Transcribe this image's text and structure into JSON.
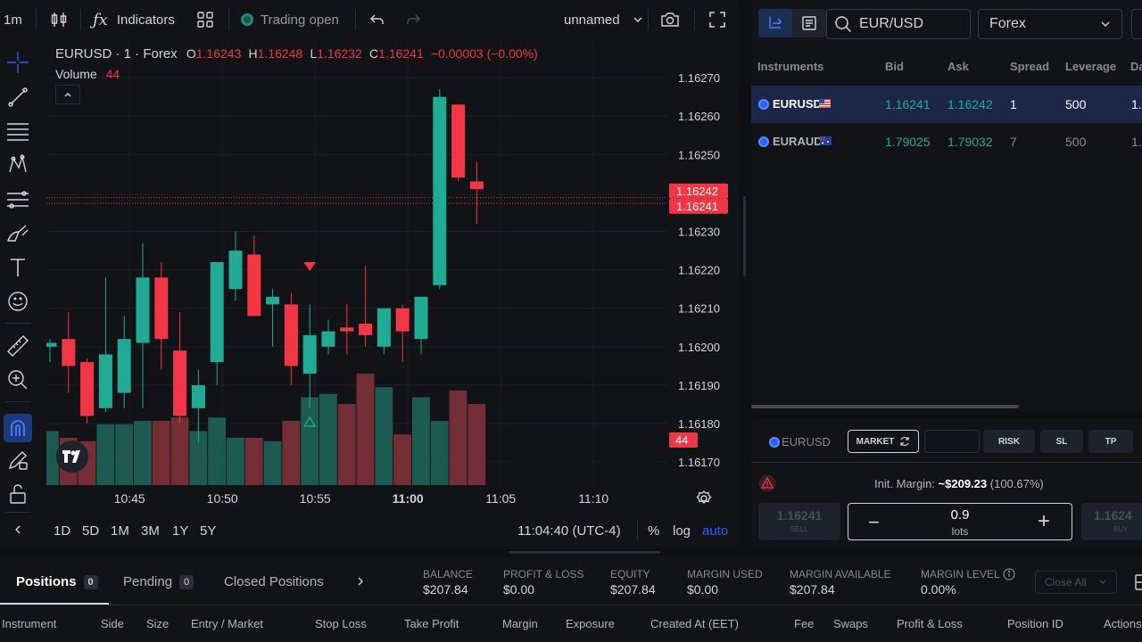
{
  "toolbar": {
    "interval": "1m",
    "indicators": "Indicators",
    "trading_status": "Trading open",
    "layout_name": "unnamed"
  },
  "legend": {
    "symbol": "EURUSD · 1 · Forex",
    "open_label": "O",
    "open": "1.16243",
    "high_label": "H",
    "high": "1.16248",
    "low_label": "L",
    "low": "1.16232",
    "close_label": "C",
    "close": "1.16241",
    "change": "−0.00003 (−0.00%)",
    "volume_label": "Volume",
    "volume": "44"
  },
  "chart_data": {
    "type": "candlestick",
    "symbol": "EURUSD",
    "price_ticks": [
      "1.16270",
      "1.16260",
      "1.16250",
      "1.16230",
      "1.16220",
      "1.16210",
      "1.16200",
      "1.16190",
      "1.16180",
      "1.16170"
    ],
    "time_ticks": [
      "10:45",
      "10:50",
      "10:55",
      "11:00",
      "11:05",
      "11:10"
    ],
    "ylim": [
      1.16164,
      1.1628
    ],
    "ask_label": "1.16242",
    "bid_label": "1.16241",
    "volume_label": "44",
    "candles": [
      {
        "o": 1.162,
        "h": 1.16202,
        "l": 1.16196,
        "c": 1.16201
      },
      {
        "o": 1.16202,
        "h": 1.16209,
        "l": 1.16188,
        "c": 1.16195
      },
      {
        "o": 1.16196,
        "h": 1.16197,
        "l": 1.1618,
        "c": 1.16182
      },
      {
        "o": 1.16184,
        "h": 1.16218,
        "l": 1.16183,
        "c": 1.16198
      },
      {
        "o": 1.16188,
        "h": 1.16208,
        "l": 1.16184,
        "c": 1.16202
      },
      {
        "o": 1.16201,
        "h": 1.16227,
        "l": 1.16184,
        "c": 1.16218
      },
      {
        "o": 1.16218,
        "h": 1.16222,
        "l": 1.16194,
        "c": 1.16202
      },
      {
        "o": 1.16199,
        "h": 1.16209,
        "l": 1.1618,
        "c": 1.16182
      },
      {
        "o": 1.16184,
        "h": 1.16194,
        "l": 1.16175,
        "c": 1.1619
      },
      {
        "o": 1.16196,
        "h": 1.16222,
        "l": 1.1619,
        "c": 1.16222
      },
      {
        "o": 1.16215,
        "h": 1.1623,
        "l": 1.16212,
        "c": 1.16225
      },
      {
        "o": 1.16224,
        "h": 1.16229,
        "l": 1.16213,
        "c": 1.16208
      },
      {
        "o": 1.16211,
        "h": 1.16215,
        "l": 1.162,
        "c": 1.16213
      },
      {
        "o": 1.16211,
        "h": 1.16214,
        "l": 1.1619,
        "c": 1.16195
      },
      {
        "o": 1.16193,
        "h": 1.16211,
        "l": 1.16184,
        "c": 1.16203
      },
      {
        "o": 1.162,
        "h": 1.16207,
        "l": 1.16198,
        "c": 1.16204
      },
      {
        "o": 1.16205,
        "h": 1.16211,
        "l": 1.16198,
        "c": 1.16204
      },
      {
        "o": 1.16206,
        "h": 1.16221,
        "l": 1.162,
        "c": 1.16203
      },
      {
        "o": 1.162,
        "h": 1.16209,
        "l": 1.16198,
        "c": 1.1621
      },
      {
        "o": 1.1621,
        "h": 1.16211,
        "l": 1.16196,
        "c": 1.16204
      },
      {
        "o": 1.16202,
        "h": 1.16213,
        "l": 1.16198,
        "c": 1.16213
      },
      {
        "o": 1.16216,
        "h": 1.16267,
        "l": 1.16215,
        "c": 1.16265
      },
      {
        "o": 1.16263,
        "h": 1.16262,
        "l": 1.16243,
        "c": 1.16244
      },
      {
        "o": 1.16243,
        "h": 1.16248,
        "l": 1.16232,
        "c": 1.16241
      }
    ],
    "volumes": [
      16,
      14,
      13,
      18,
      18,
      19,
      19,
      20,
      16,
      20,
      14,
      14,
      13,
      19,
      26,
      27,
      24,
      33,
      29,
      15,
      26,
      19,
      28,
      24
    ],
    "volume_max": 33
  },
  "bottom_bar": {
    "ranges": [
      "1D",
      "5D",
      "1M",
      "3M",
      "1Y",
      "5Y"
    ],
    "clock": "11:04:40 (UTC-4)",
    "percent": "%",
    "log": "log",
    "auto": "auto"
  },
  "search": {
    "value": "EUR/USD",
    "market": "Forex"
  },
  "instruments_table": {
    "headers": [
      "Instruments",
      "Bid",
      "Ask",
      "Spread",
      "Leverage",
      "Da"
    ],
    "rows": [
      {
        "name": "EURUSD",
        "bid": "1.16241",
        "ask": "1.16242",
        "spread": "1",
        "leverage": "500",
        "extra": "1."
      },
      {
        "name": "EURAUD",
        "bid": "1.79025",
        "ask": "1.79032",
        "spread": "7",
        "leverage": "500",
        "extra": "1."
      }
    ]
  },
  "order": {
    "symbol": "EURUSD",
    "market_btn": "MARKET",
    "risk_btn": "RISK",
    "sl_btn": "SL",
    "tp_btn": "TP",
    "margin_label": "Init. Margin:",
    "margin_value": "~$209.23",
    "margin_pct": "(100.67%)",
    "sell_price": "1.16241",
    "sell_label": "SELL",
    "lots_value": "0.9",
    "lots_label": "lots",
    "buy_price": "1.1624",
    "buy_label": "BUY"
  },
  "positions_tabs": [
    {
      "label": "Positions",
      "count": "0"
    },
    {
      "label": "Pending",
      "count": "0"
    },
    {
      "label": "Closed Positions",
      "count": ""
    }
  ],
  "account": [
    {
      "label": "BALANCE",
      "value": "$207.84"
    },
    {
      "label": "PROFIT & LOSS",
      "value": "$0.00"
    },
    {
      "label": "EQUITY",
      "value": "$207.84"
    },
    {
      "label": "MARGIN USED",
      "value": "$0.00"
    },
    {
      "label": "MARGIN AVAILABLE",
      "value": "$207.84"
    },
    {
      "label": "MARGIN LEVEL",
      "value": "0.00%"
    }
  ],
  "close_all": "Close All",
  "positions_columns": [
    "Instrument",
    "Side",
    "Size",
    "Entry / Market",
    "Stop Loss",
    "Take Profit",
    "Margin",
    "Exposure",
    "Created At (EET)",
    "Fee",
    "Swaps",
    "Profit & Loss",
    "Position ID",
    "Actions"
  ],
  "colors": {
    "up": "#22ab94",
    "down": "#f23645",
    "accent": "#2962ff",
    "bg": "#121317"
  }
}
